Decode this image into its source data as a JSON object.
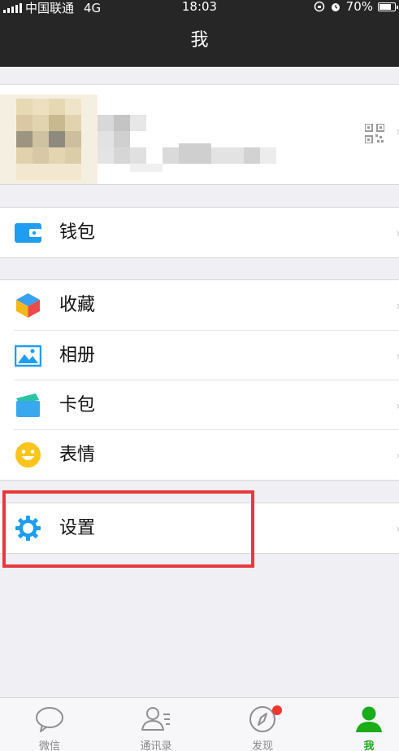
{
  "status_bar": {
    "carrier": "中国联通",
    "network": "4G",
    "time": "18:03",
    "battery": "70%"
  },
  "nav": {
    "title": "我"
  },
  "menu": {
    "wallet": "钱包",
    "favorites": "收藏",
    "album": "相册",
    "cards": "卡包",
    "stickers": "表情",
    "settings": "设置"
  },
  "tabbar": {
    "chats": "微信",
    "contacts": "通讯录",
    "discover": "发现",
    "me": "我"
  },
  "colors": {
    "accent_green": "#1aad19",
    "highlight_red": "#e8383d",
    "icon_blue": "#1f9df0"
  }
}
